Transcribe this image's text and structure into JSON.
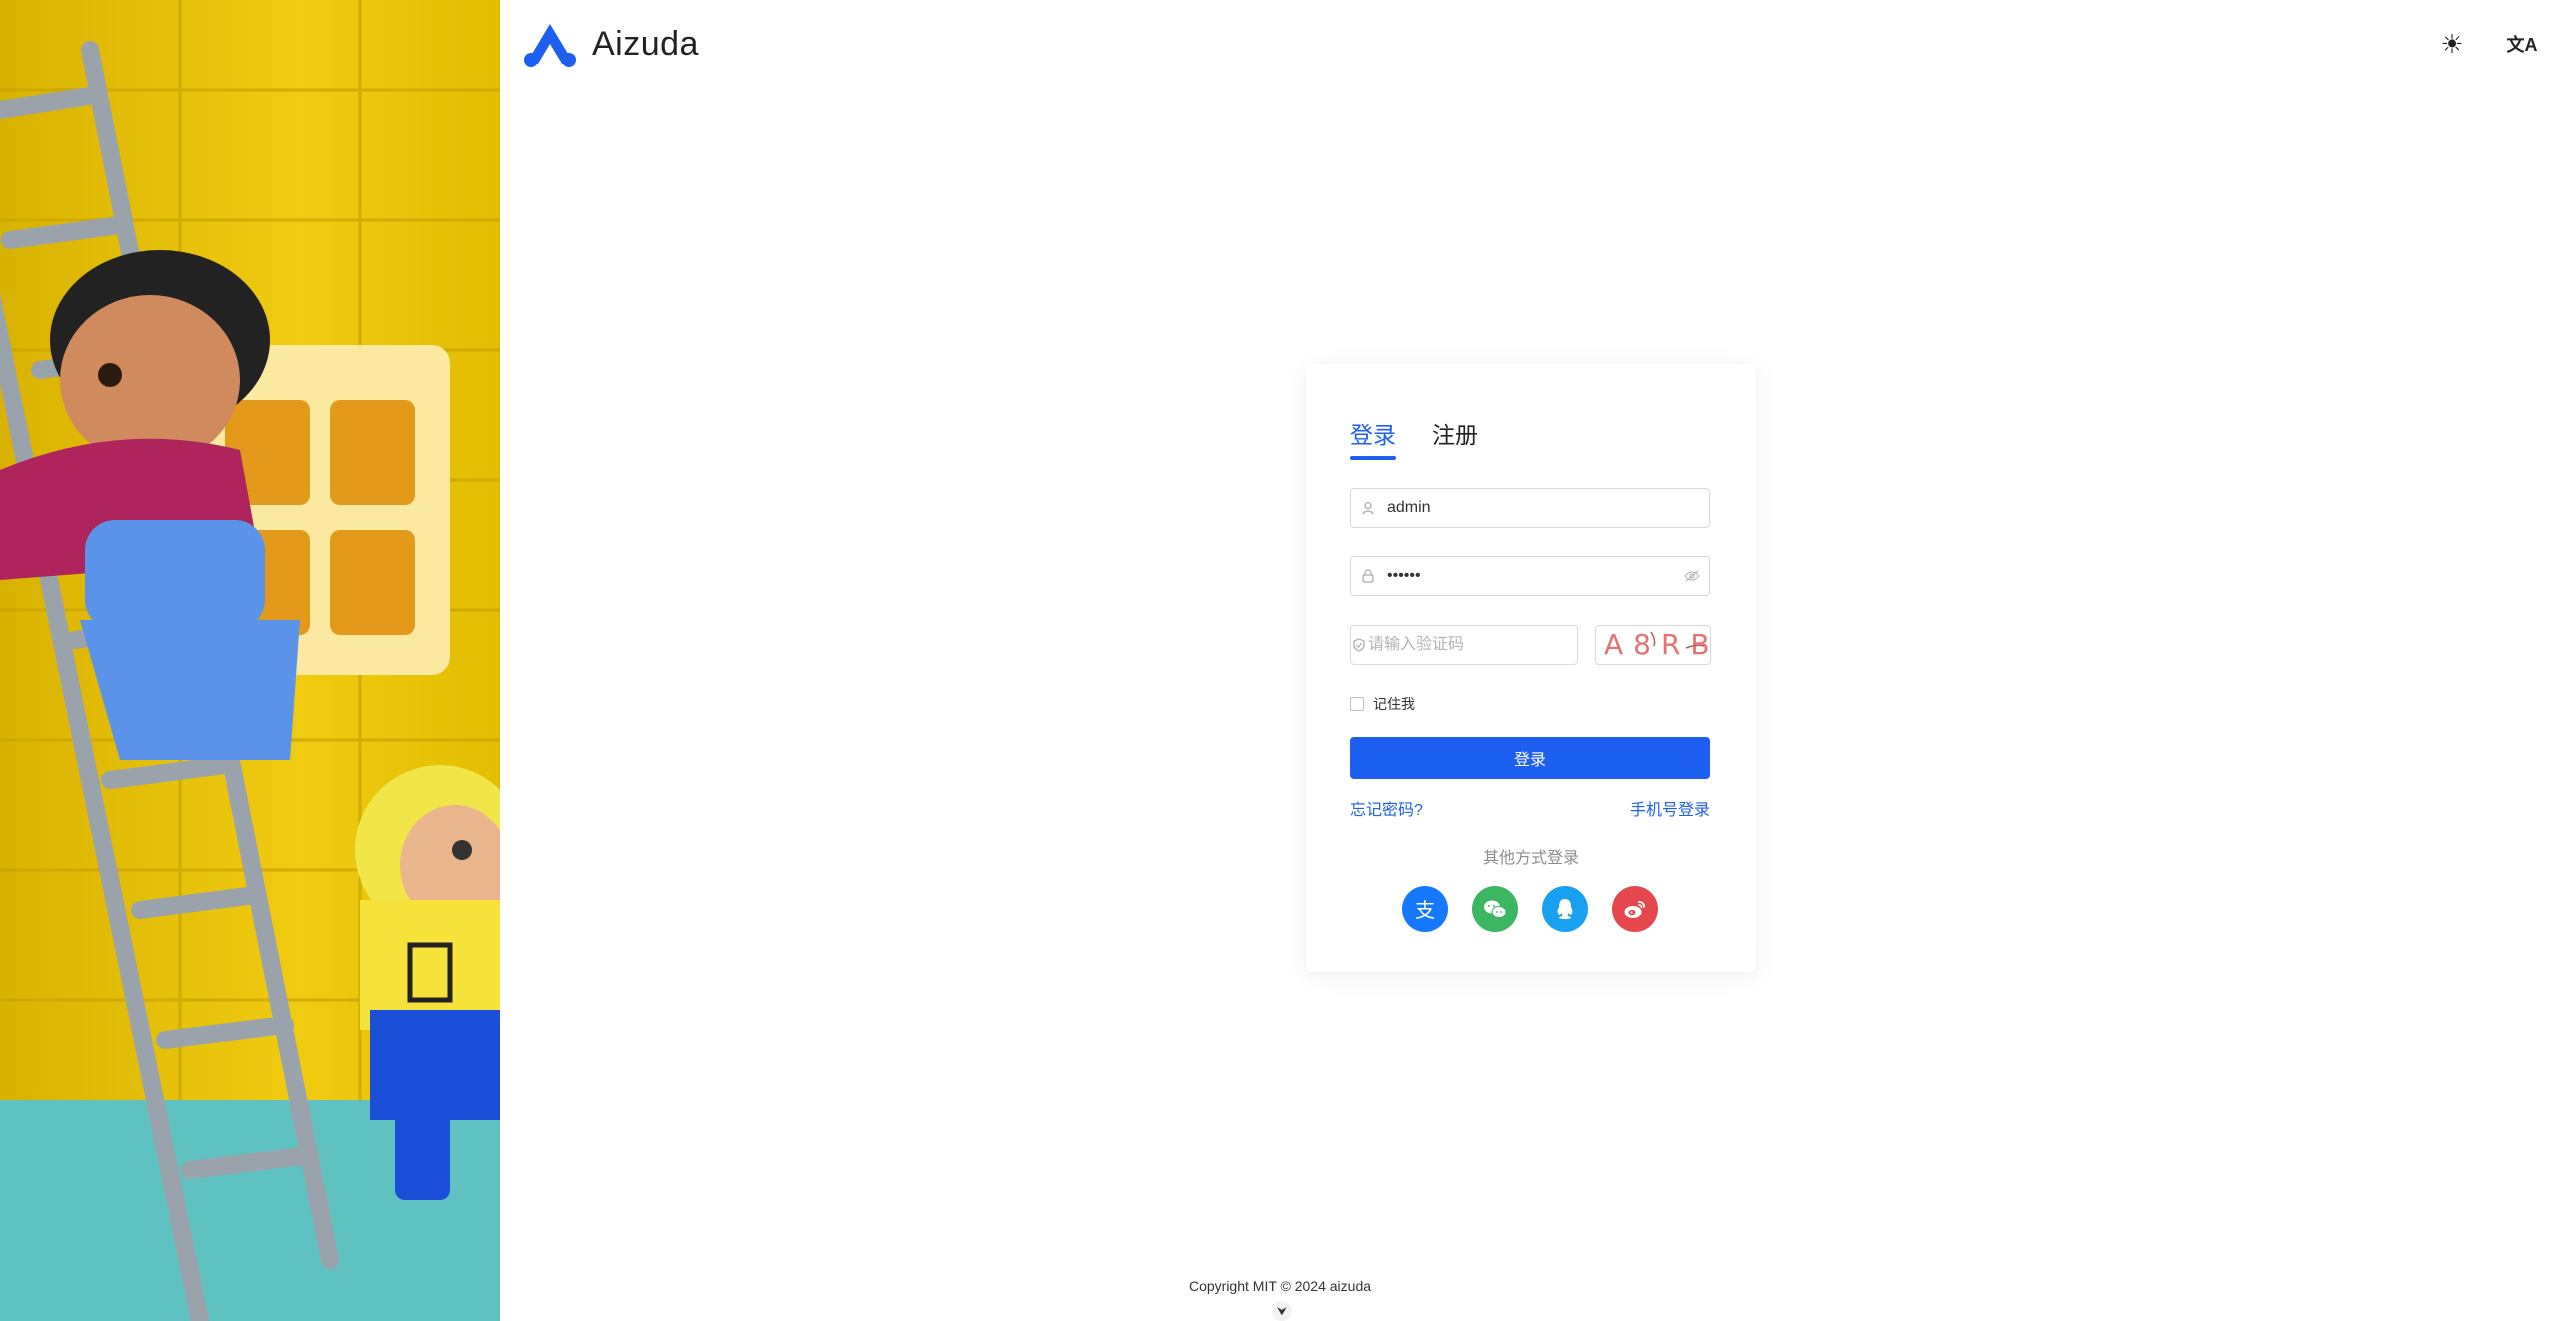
{
  "brand": {
    "name": "Aizuda",
    "accent": "#1d5ff0"
  },
  "topbar": {
    "theme_icon": "sun-icon",
    "language_icon": "translate-icon",
    "theme_glyph": "☀",
    "language_glyph": "文A"
  },
  "illustration": {
    "description_icon": "toy-figures-illustration"
  },
  "login": {
    "tabs": [
      {
        "label": "登录",
        "active": true
      },
      {
        "label": "注册",
        "active": false
      }
    ],
    "username_value": "admin",
    "password_value": "••••••",
    "captcha_placeholder": "请输入验证码",
    "captcha_text": "A8RB",
    "remember_label": "记住我",
    "submit_label": "登录",
    "forgot_label": "忘记密码?",
    "phone_login_label": "手机号登录",
    "other_methods_label": "其他方式登录",
    "socials": [
      {
        "name": "alipay-icon",
        "color": "#1677ff",
        "glyph": "支"
      },
      {
        "name": "wechat-icon",
        "color": "#3cb660"
      },
      {
        "name": "qq-icon",
        "color": "#1aa0f0"
      },
      {
        "name": "weibo-icon",
        "color": "#e5474e"
      }
    ]
  },
  "footer": {
    "copyright": "Copyright MIT © 2024 aizuda",
    "collapse_glyph": "⮟"
  }
}
